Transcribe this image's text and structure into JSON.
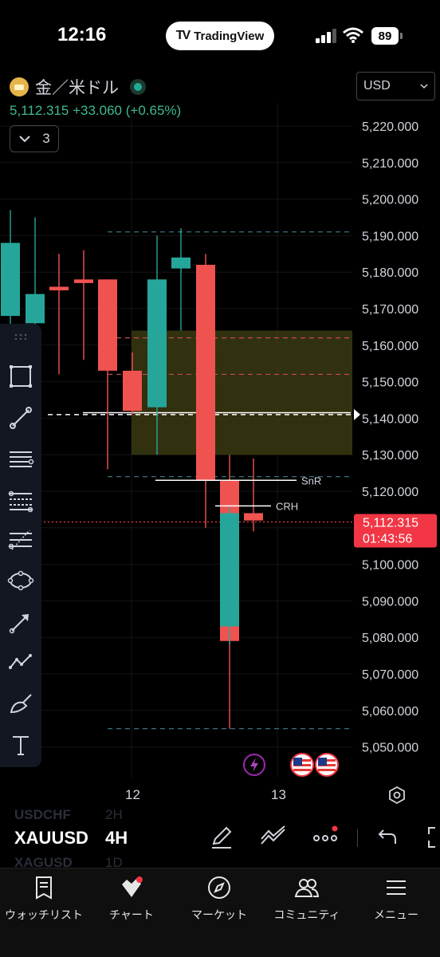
{
  "status_bar": {
    "time": "12:16",
    "app_pill": "TradingView",
    "battery": "89"
  },
  "header": {
    "symbol_name": "金／米ドル",
    "price_text": "5,112.315 +33.060 (+0.65%)",
    "collapse_count": "3",
    "currency": "USD"
  },
  "chart_data": {
    "type": "candlestick",
    "title": "",
    "x_tick_labels": [
      "12",
      "13"
    ],
    "y_tick_labels": [
      "5,220.000",
      "5,210.000",
      "5,200.000",
      "5,190.000",
      "5,180.000",
      "5,170.000",
      "5,160.000",
      "5,150.000",
      "5,140.000",
      "5,130.000",
      "5,120.000",
      "5,110.000",
      "5,100.000",
      "5,090.000",
      "5,080.000",
      "5,070.000",
      "5,060.000",
      "5,050.000"
    ],
    "ylim": [
      5045,
      5225
    ],
    "candles": [
      {
        "o": 5168,
        "h": 5197,
        "l": 5164,
        "c": 5188
      },
      {
        "o": 5166,
        "h": 5195,
        "l": 5161,
        "c": 5174
      },
      {
        "o": 5176,
        "h": 5185,
        "l": 5152,
        "c": 5175
      },
      {
        "o": 5178,
        "h": 5186,
        "l": 5156,
        "c": 5177
      },
      {
        "o": 5178,
        "h": 5178,
        "l": 5126,
        "c": 5153
      },
      {
        "o": 5153,
        "h": 5158,
        "l": 5141,
        "c": 5142
      },
      {
        "o": 5143,
        "h": 5190,
        "l": 5130,
        "c": 5178
      },
      {
        "o": 5181,
        "h": 5192,
        "l": 5164,
        "c": 5184
      },
      {
        "o": 5182,
        "h": 5185,
        "l": 5110,
        "c": 5123
      },
      {
        "o": 5123,
        "h": 5130,
        "l": 5055,
        "c": 5079
      },
      {
        "o": 5083,
        "h": 5116,
        "l": 5078,
        "c": 5114
      },
      {
        "o": 5114,
        "h": 5129,
        "l": 5109,
        "c": 5112
      }
    ],
    "zone": {
      "from": 5130,
      "to": 5164
    },
    "horizontal_levels": [
      {
        "price": 5191,
        "style": "dashed",
        "color": "#3f7f8c"
      },
      {
        "price": 5162,
        "style": "dashed",
        "color": "#c74b55"
      },
      {
        "price": 5152,
        "style": "dashed",
        "color": "#c74b55"
      },
      {
        "price": 5141,
        "style": "dashed",
        "color": "#ffffff"
      },
      {
        "price": 5124,
        "style": "dashed",
        "color": "#3f7f8c"
      },
      {
        "price": 5055,
        "style": "dashed",
        "color": "#3f7f8c"
      },
      {
        "price": 5111.6,
        "style": "dotted",
        "color": "#f23645"
      }
    ],
    "annotations": [
      {
        "label": "SnR",
        "price": 5123
      },
      {
        "label": "CRH",
        "price": 5116
      }
    ],
    "current_price": {
      "value": "5,112.315",
      "countdown": "01:43:56",
      "color": "#f23645"
    },
    "colors": {
      "up": "#26a69a",
      "down": "#ef5350",
      "zone": "#3b3a12"
    }
  },
  "symbol_switcher": {
    "previous": "USDCHF",
    "previous_tf": "2H",
    "current": "XAUUSD",
    "current_tf": "4H",
    "next": "XAGUSD",
    "next_tf": "1D"
  },
  "tabs": [
    {
      "label": "ウォッチリスト",
      "icon": "watchlist-icon"
    },
    {
      "label": "チャート",
      "icon": "chart-icon"
    },
    {
      "label": "マーケット",
      "icon": "compass-icon"
    },
    {
      "label": "コミュニティ",
      "icon": "community-icon"
    },
    {
      "label": "メニュー",
      "icon": "menu-icon"
    }
  ]
}
